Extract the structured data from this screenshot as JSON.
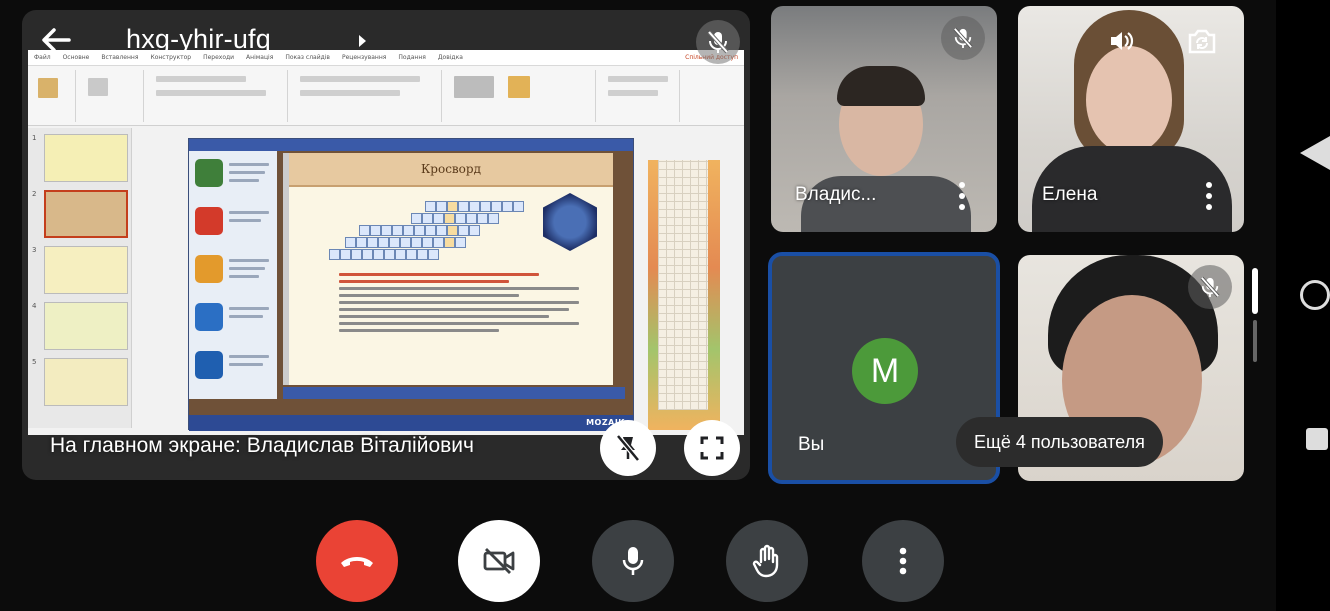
{
  "meeting": {
    "code": "hxg-yhir-ufq",
    "presenter_caption": "На главном экране: Владислав Віталійович"
  },
  "shared_screen": {
    "mozaik_title": "Кросворд",
    "mozaik_brand": "MOZAIK"
  },
  "participants": [
    {
      "name": "Владис...",
      "muted": true
    },
    {
      "name": "Елена",
      "muted": false
    },
    {
      "name": "Вы",
      "avatar_letter": "M",
      "avatar_color": "#4c9a3a"
    }
  ],
  "more_users": "Ещё 4 пользователя",
  "colors": {
    "leave": "#ea4335",
    "selected_tile_border": "#1a4fa5",
    "control_bg": "#3c4043"
  }
}
